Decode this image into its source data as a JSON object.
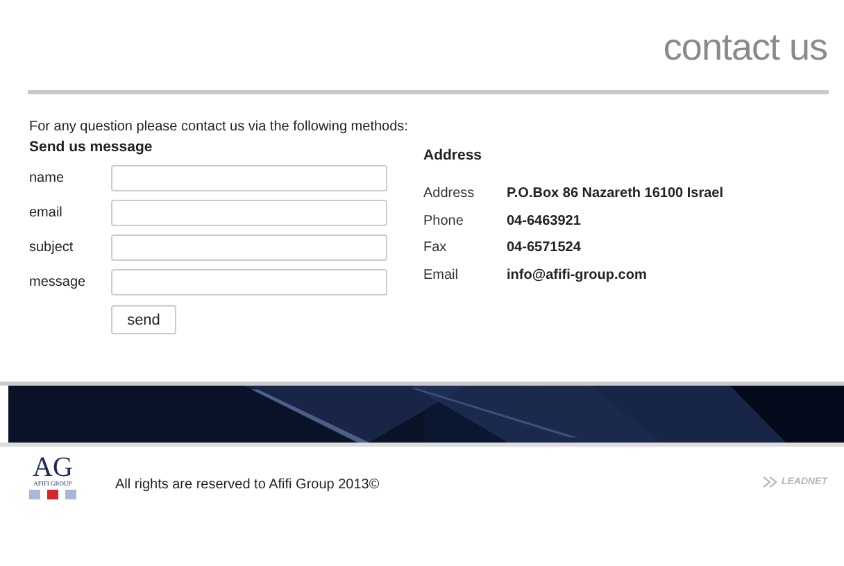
{
  "page_title": "contact us",
  "intro": "For any question please contact us via the following methods:",
  "form": {
    "heading": "Send us message",
    "fields": [
      {
        "label": "name"
      },
      {
        "label": "email"
      },
      {
        "label": "subject"
      },
      {
        "label": "message"
      }
    ],
    "button": "send"
  },
  "address": {
    "heading": "Address",
    "rows": [
      {
        "label": "Address",
        "value": "P.O.Box 86 Nazareth 16100 Israel"
      },
      {
        "label": "Phone",
        "value": "04-6463921"
      },
      {
        "label": "Fax",
        "value": "04-6571524"
      },
      {
        "label": "Email",
        "value": "info@afifi-group.com"
      }
    ]
  },
  "footer": {
    "logo_mark": "AG",
    "logo_name": "AFIFI GROUP",
    "copyright": "All rights are reserved to Afifi Group 2013©",
    "credit": "LEADNET"
  }
}
